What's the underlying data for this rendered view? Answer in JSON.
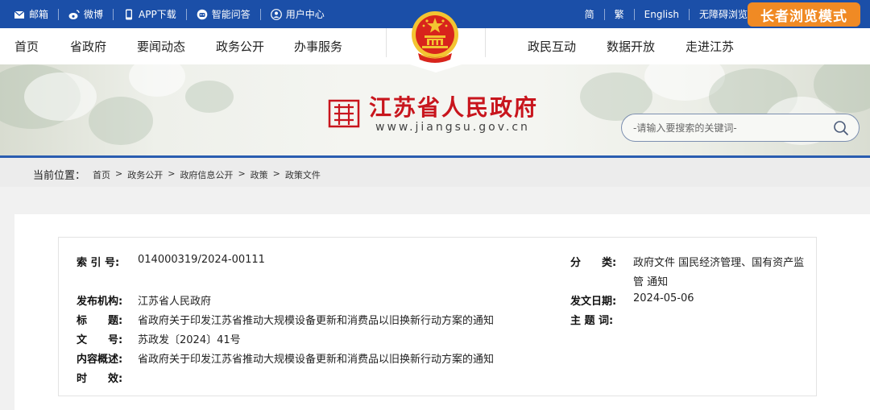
{
  "topbar": {
    "mail": "邮箱",
    "weibo": "微博",
    "app": "APP下载",
    "qa": "智能问答",
    "user": "用户中心",
    "simplified": "简",
    "traditional": "繁",
    "english": "English",
    "accessible": "无障碍浏览",
    "elder_mode": "长者浏览模式"
  },
  "nav": {
    "items_left": [
      "首页",
      "省政府",
      "要闻动态",
      "政务公开",
      "办事服务"
    ],
    "items_right": [
      "政民互动",
      "数据开放",
      "走进江苏"
    ]
  },
  "site": {
    "title": "江苏省人民政府",
    "url": "www.jiangsu.gov.cn"
  },
  "search": {
    "placeholder": "-请输入要搜索的关键词-"
  },
  "breadcrumb": {
    "label": "当前位置：",
    "items": [
      "首页",
      "政务公开",
      "政府信息公开",
      "政策",
      "政策文件"
    ],
    "sep": ">"
  },
  "doc": {
    "index_label": "索 引 号:",
    "index_value": "014000319/2024-00111",
    "category_label": "分　　类:",
    "category_value_line1": "政府文件 国民经济管理、国有资产监",
    "category_value_line2": "管 通知",
    "issuer_label": "发布机构:",
    "issuer_value": "江苏省人民政府",
    "date_label": "发文日期:",
    "date_value": "2024-05-06",
    "title_label": "标　　题:",
    "title_value": "省政府关于印发江苏省推动大规模设备更新和消费品以旧换新行动方案的通知",
    "keywords_label": "主 题 词:",
    "keywords_value": "",
    "docno_label": "文　　号:",
    "docno_value": "苏政发〔2024〕41号",
    "summary_label": "内容概述:",
    "summary_value": "省政府关于印发江苏省推动大规模设备更新和消费品以旧换新行动方案的通知",
    "validity_label": "时　　效:",
    "validity_value": ""
  },
  "colors": {
    "topbar": "#1b4fa8",
    "elder_button": "#f08a24",
    "title_red": "#c8151d"
  }
}
